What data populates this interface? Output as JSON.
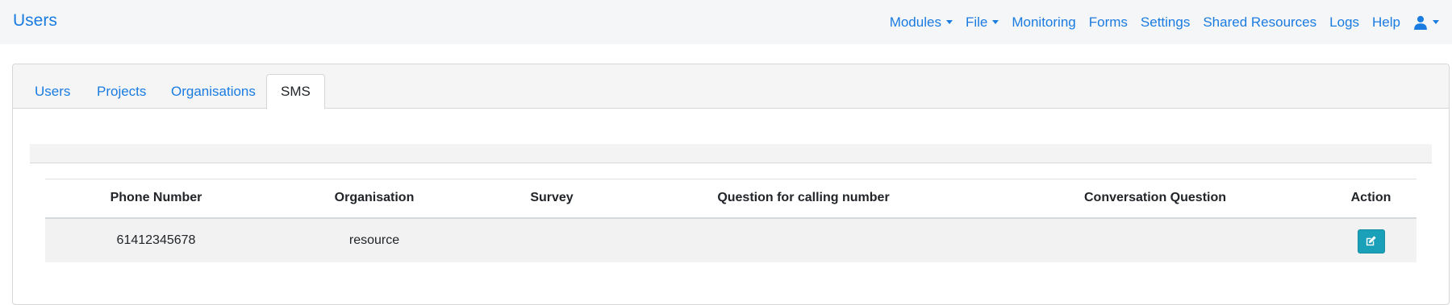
{
  "navbar": {
    "brand": "Users",
    "items": [
      {
        "label": "Modules",
        "dropdown": true
      },
      {
        "label": "File",
        "dropdown": true
      },
      {
        "label": "Monitoring",
        "dropdown": false
      },
      {
        "label": "Forms",
        "dropdown": false
      },
      {
        "label": "Settings",
        "dropdown": false
      },
      {
        "label": "Shared Resources",
        "dropdown": false
      },
      {
        "label": "Logs",
        "dropdown": false
      },
      {
        "label": "Help",
        "dropdown": false
      }
    ],
    "user_icon": "user-icon"
  },
  "tabs": {
    "users": "Users",
    "projects": "Projects",
    "organisations": "Organisations",
    "sms": "SMS",
    "active": "SMS"
  },
  "table": {
    "headers": {
      "phone": "Phone Number",
      "organisation": "Organisation",
      "survey": "Survey",
      "question": "Question for calling number",
      "conversation": "Conversation Question",
      "action": "Action"
    },
    "rows": [
      {
        "phone": "61412345678",
        "organisation": "resource",
        "survey": "",
        "question": "",
        "conversation": "",
        "action_icon": "edit-icon"
      }
    ]
  },
  "colors": {
    "link": "#1a7be0",
    "navbar_bg": "#f5f6f8",
    "edit_button": "#1aa0b8"
  }
}
